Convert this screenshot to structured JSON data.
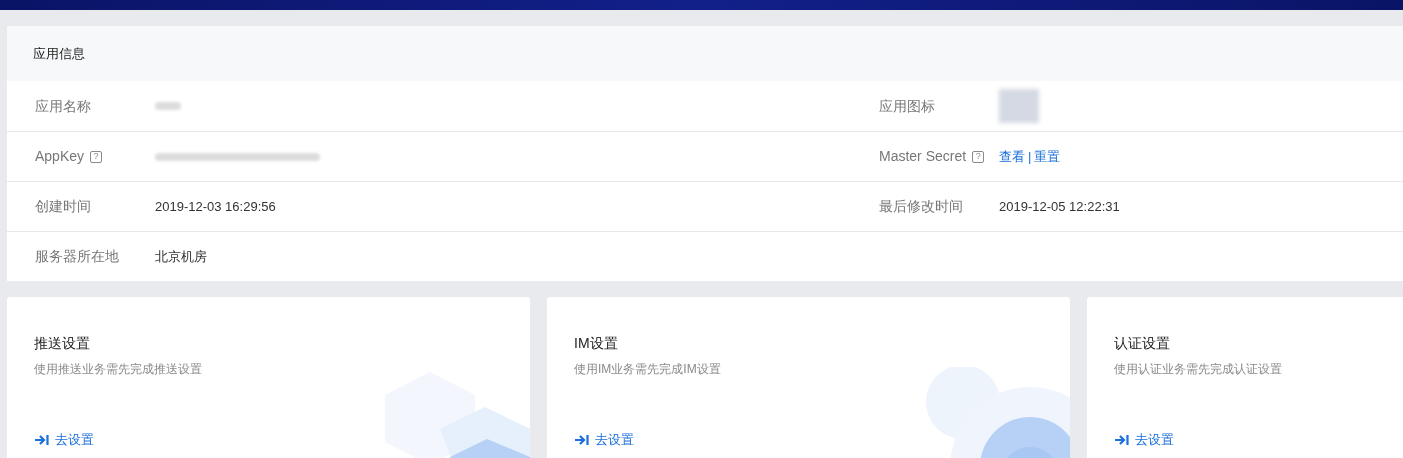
{
  "app_info": {
    "title": "应用信息",
    "rows": [
      [
        {
          "label": "应用名称",
          "kind": "redacted"
        },
        {
          "label": "应用图标",
          "kind": "image"
        }
      ],
      [
        {
          "label": "AppKey",
          "help": "?",
          "kind": "redacted"
        },
        {
          "label": "Master Secret",
          "help": "?",
          "kind": "links",
          "links": [
            "查看",
            "重置"
          ],
          "separator": "|"
        }
      ],
      [
        {
          "label": "创建时间",
          "kind": "text",
          "value": "2019-12-03 16:29:56"
        },
        {
          "label": "最后修改时间",
          "kind": "text",
          "value": "2019-12-05 12:22:31"
        }
      ],
      [
        {
          "label": "服务器所在地",
          "kind": "text",
          "value": "北京机房"
        }
      ]
    ]
  },
  "cards": [
    {
      "title": "推送设置",
      "description": "使用推送业务需先完成推送设置",
      "link": "去设置",
      "kind": "hexagons"
    },
    {
      "title": "IM设置",
      "description": "使用IM业务需先完成IM设置",
      "link": "去设置",
      "kind": "circles"
    },
    {
      "title": "认证设置",
      "description": "使用认证业务需先完成认证设置",
      "link": "去设置",
      "kind": "plain"
    }
  ]
}
